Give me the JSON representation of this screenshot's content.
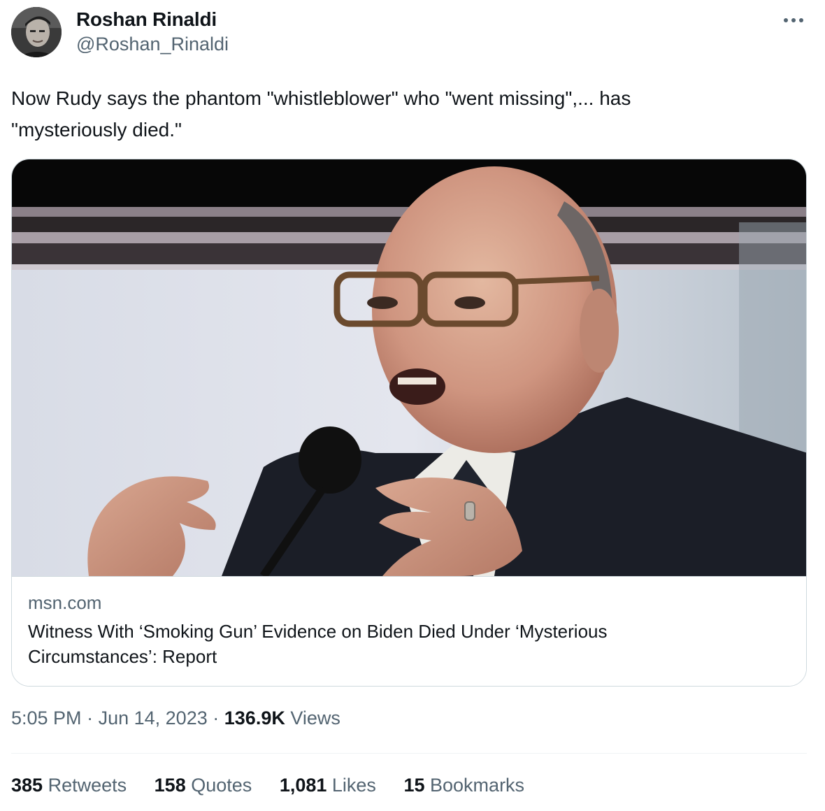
{
  "author": {
    "name": "Roshan Rinaldi",
    "handle": "@Roshan_Rinaldi"
  },
  "tweet": {
    "text": "Now Rudy says the phantom \"whistleblower\" who \"went missing\",... has \"mysteriously died.\""
  },
  "card": {
    "domain": "msn.com",
    "title": "Witness With ‘Smoking Gun’ Evidence on Biden Died Under ‘Mysterious Circumstances’: Report"
  },
  "meta": {
    "time": "5:05 PM",
    "separator": "·",
    "date": "Jun 14, 2023",
    "views_count": "136.9K",
    "views_label": "Views"
  },
  "stats": {
    "retweets": {
      "count": "385",
      "label": "Retweets"
    },
    "quotes": {
      "count": "158",
      "label": "Quotes"
    },
    "likes": {
      "count": "1,081",
      "label": "Likes"
    },
    "bookmarks": {
      "count": "15",
      "label": "Bookmarks"
    }
  },
  "icons": {
    "more": "more-horizontal-icon"
  },
  "colors": {
    "text_primary": "#0f1419",
    "text_secondary": "#536471",
    "border": "#cfd9de"
  }
}
